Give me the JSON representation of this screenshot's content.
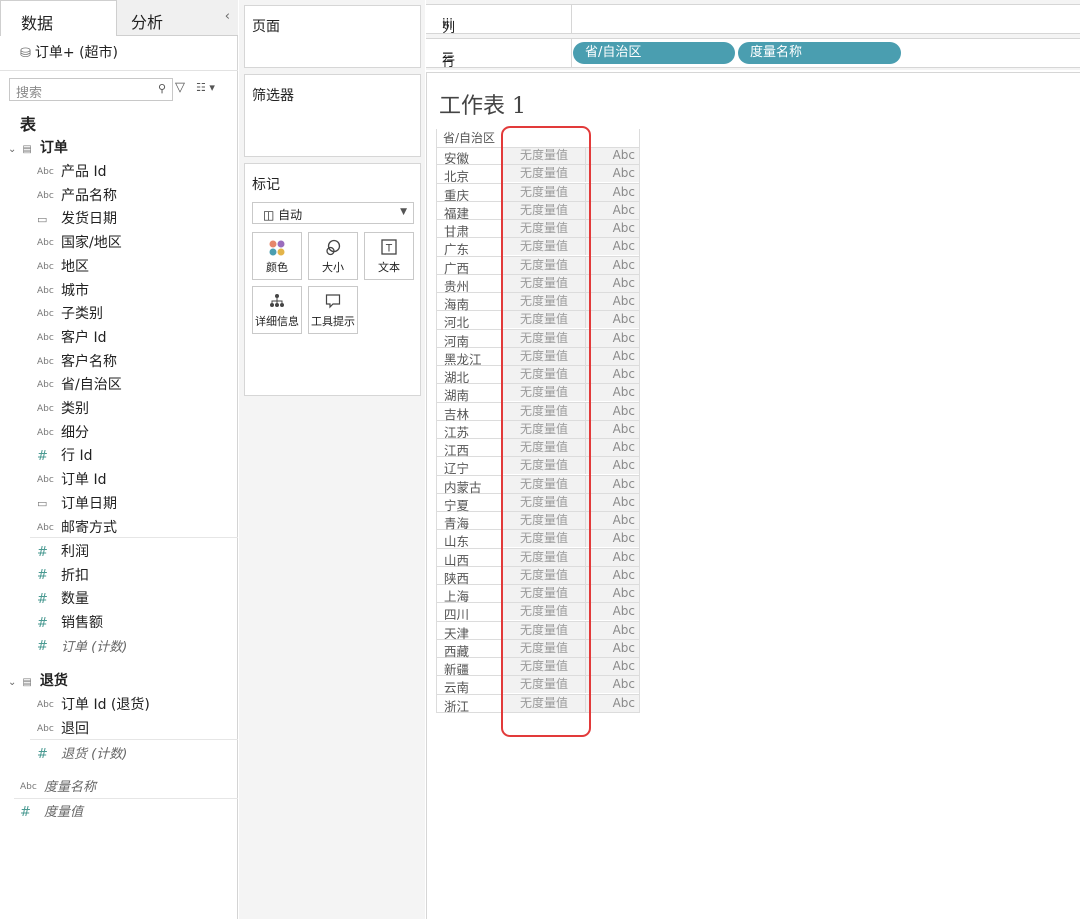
{
  "tabs": {
    "data": "数据",
    "analysis": "分析",
    "collapse": "‹"
  },
  "datasource": "订单+ (超市)",
  "search": {
    "placeholder": "搜索"
  },
  "tables_label": "表",
  "orders": {
    "title": "订单",
    "fields": [
      {
        "type": "Abc",
        "name": "产品 Id"
      },
      {
        "type": "Abc",
        "name": "产品名称"
      },
      {
        "type": "date",
        "name": "发货日期"
      },
      {
        "type": "Abc",
        "name": "国家/地区"
      },
      {
        "type": "Abc",
        "name": "地区"
      },
      {
        "type": "Abc",
        "name": "城市"
      },
      {
        "type": "Abc",
        "name": "子类别"
      },
      {
        "type": "Abc",
        "name": "客户 Id"
      },
      {
        "type": "Abc",
        "name": "客户名称"
      },
      {
        "type": "Abc",
        "name": "省/自治区"
      },
      {
        "type": "Abc",
        "name": "类别"
      },
      {
        "type": "Abc",
        "name": "细分"
      },
      {
        "type": "#",
        "name": "行 Id"
      },
      {
        "type": "Abc",
        "name": "订单 Id"
      },
      {
        "type": "date",
        "name": "订单日期"
      },
      {
        "type": "Abc",
        "name": "邮寄方式"
      }
    ],
    "measures": [
      {
        "type": "#",
        "name": "利润"
      },
      {
        "type": "#",
        "name": "折扣"
      },
      {
        "type": "#",
        "name": "数量"
      },
      {
        "type": "#",
        "name": "销售额"
      },
      {
        "type": "#",
        "name": "订单 (计数)"
      }
    ]
  },
  "returns": {
    "title": "退货",
    "fields": [
      {
        "type": "Abc",
        "name": "订单 Id (退货)"
      },
      {
        "type": "Abc",
        "name": "退回"
      }
    ],
    "measures": [
      {
        "type": "#",
        "name": "退货 (计数)"
      }
    ]
  },
  "measure_names": {
    "type": "Abc",
    "name": "度量名称"
  },
  "measure_values": {
    "type": "#",
    "name": "度量值"
  },
  "cards": {
    "pages": "页面",
    "filters": "筛选器",
    "marks": "标记",
    "marks_type": "自动",
    "buttons": [
      "颜色",
      "大小",
      "文本",
      "详细信息",
      "工具提示"
    ]
  },
  "shelves": {
    "columns_icon": "iii",
    "columns": "列",
    "rows_icon": "☰",
    "rows": "行",
    "row_pills": [
      "省/自治区",
      "度量名称"
    ]
  },
  "sheet": {
    "title": "工作表 1",
    "column_header": "省/自治区",
    "provinces": [
      "安徽",
      "北京",
      "重庆",
      "福建",
      "甘肃",
      "广东",
      "广西",
      "贵州",
      "海南",
      "河北",
      "河南",
      "黑龙江",
      "湖北",
      "湖南",
      "吉林",
      "江苏",
      "江西",
      "辽宁",
      "内蒙古",
      "宁夏",
      "青海",
      "山东",
      "山西",
      "陕西",
      "上海",
      "四川",
      "天津",
      "西藏",
      "新疆",
      "云南",
      "浙江"
    ],
    "measure_cell": "无度量值",
    "abc_cell": "Abc"
  },
  "colors": {
    "pill": "#4a9eb0",
    "highlight": "#e23a3a"
  }
}
